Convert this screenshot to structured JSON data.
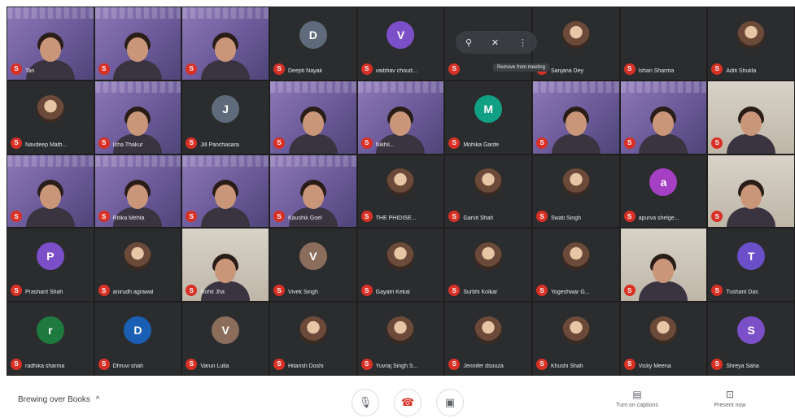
{
  "colors": {
    "grid_bg": "#1f1f20",
    "muted_badge": "#d93025",
    "accent": "#8e78b8"
  },
  "tiles": [
    {
      "row": 0,
      "col": 0,
      "type": "purple",
      "label": "Tan"
    },
    {
      "row": 0,
      "col": 1,
      "type": "purple",
      "label": ""
    },
    {
      "row": 0,
      "col": 2,
      "type": "purple",
      "label": ""
    },
    {
      "row": 0,
      "col": 3,
      "type": "avatar",
      "avatar": "D",
      "avatar_color": "#5f6b7a",
      "label": "Deepti Nayak"
    },
    {
      "row": 0,
      "col": 4,
      "type": "avatar",
      "avatar": "V",
      "avatar_color": "#7b4fc8",
      "label": "vaibhav choud..."
    },
    {
      "row": 0,
      "col": 5,
      "type": "dark",
      "label": ""
    },
    {
      "row": 0,
      "col": 6,
      "type": "photo",
      "label": "Sanjana Dey"
    },
    {
      "row": 0,
      "col": 7,
      "type": "dark",
      "label": "Ishan Sharma"
    },
    {
      "row": 0,
      "col": 8,
      "type": "photo",
      "label": "Aditi Shukla"
    },
    {
      "row": 1,
      "col": 0,
      "type": "photo",
      "label": "Navdeep Math..."
    },
    {
      "row": 1,
      "col": 1,
      "type": "purple",
      "label": "Isha Thakur"
    },
    {
      "row": 1,
      "col": 2,
      "type": "avatar",
      "avatar": "J",
      "avatar_color": "#5f6b7a",
      "label": "Jill Panchasara"
    },
    {
      "row": 1,
      "col": 3,
      "type": "purple",
      "label": ""
    },
    {
      "row": 1,
      "col": 4,
      "type": "purple",
      "label": "Nikhil..."
    },
    {
      "row": 1,
      "col": 5,
      "type": "avatar",
      "avatar": "M",
      "avatar_color": "#12a085",
      "label": "Mohika Garde"
    },
    {
      "row": 1,
      "col": 6,
      "type": "purple",
      "label": ""
    },
    {
      "row": 1,
      "col": 7,
      "type": "purple",
      "label": ""
    },
    {
      "row": 1,
      "col": 8,
      "type": "room",
      "label": ""
    },
    {
      "row": 2,
      "col": 0,
      "type": "purple",
      "label": ""
    },
    {
      "row": 2,
      "col": 1,
      "type": "purple",
      "label": "Ritika Mehta"
    },
    {
      "row": 2,
      "col": 2,
      "type": "purple",
      "label": ""
    },
    {
      "row": 2,
      "col": 3,
      "type": "purple",
      "label": "Kaushik Goel"
    },
    {
      "row": 2,
      "col": 4,
      "type": "photo",
      "label": "THE PHIDISE..."
    },
    {
      "row": 2,
      "col": 5,
      "type": "photo",
      "label": "Garvit Shah"
    },
    {
      "row": 2,
      "col": 6,
      "type": "photo",
      "label": "Swati Singh"
    },
    {
      "row": 2,
      "col": 7,
      "type": "avatar",
      "avatar": "a",
      "avatar_color": "#a53fc4",
      "label": "apurva shelge..."
    },
    {
      "row": 2,
      "col": 8,
      "type": "room",
      "label": ""
    },
    {
      "row": 3,
      "col": 0,
      "type": "avatar",
      "avatar": "P",
      "avatar_color": "#7b4fc8",
      "label": "Prashant Shah"
    },
    {
      "row": 3,
      "col": 1,
      "type": "photo",
      "label": "anirudh agrawal"
    },
    {
      "row": 3,
      "col": 2,
      "type": "room",
      "label": "Rohit Jha"
    },
    {
      "row": 3,
      "col": 3,
      "type": "avatar",
      "avatar": "V",
      "avatar_color": "#8a6d5b",
      "label": "Vivek Singh"
    },
    {
      "row": 3,
      "col": 4,
      "type": "photo",
      "label": "Gayatri Kekal"
    },
    {
      "row": 3,
      "col": 5,
      "type": "photo",
      "label": "Surbhi Kolkar"
    },
    {
      "row": 3,
      "col": 6,
      "type": "photo",
      "label": "Yogeshwar G..."
    },
    {
      "row": 3,
      "col": 7,
      "type": "room",
      "label": ""
    },
    {
      "row": 3,
      "col": 8,
      "type": "avatar",
      "avatar": "T",
      "avatar_color": "#6a4fc8",
      "label": "Tushant Das"
    },
    {
      "row": 4,
      "col": 0,
      "type": "avatar",
      "avatar": "r",
      "avatar_color": "#1e7a3e",
      "label": "radhika sharma"
    },
    {
      "row": 4,
      "col": 1,
      "type": "avatar",
      "avatar": "D",
      "avatar_color": "#1a5fb4",
      "label": "Dhruvi shah"
    },
    {
      "row": 4,
      "col": 2,
      "type": "avatar",
      "avatar": "V",
      "avatar_color": "#8a6d5b",
      "label": "Varun Lulla"
    },
    {
      "row": 4,
      "col": 3,
      "type": "photo",
      "label": "Hitansh Doshi"
    },
    {
      "row": 4,
      "col": 4,
      "type": "photo",
      "label": "Yuvraj Singh S..."
    },
    {
      "row": 4,
      "col": 5,
      "type": "photo",
      "label": "Jennifer dsouza"
    },
    {
      "row": 4,
      "col": 6,
      "type": "photo",
      "label": "Khushi Shah"
    },
    {
      "row": 4,
      "col": 7,
      "type": "photo",
      "label": "Vicky Meena"
    },
    {
      "row": 4,
      "col": 8,
      "type": "avatar",
      "avatar": "S",
      "avatar_color": "#7b4fc8",
      "label": "Shreya Saha"
    }
  ],
  "hover_controls": {
    "pin_icon": "pin-icon",
    "mute_icon": "mic-off-icon",
    "more_icon": "more-icon",
    "tooltip": "Remove from meeting"
  },
  "toolbar": {
    "meeting_title": "Brewing over Books",
    "chevron": "^",
    "mic_icon": "🎙",
    "hangup_icon": "☎",
    "camera_icon": "▣",
    "captions_label": "Turn on captions",
    "present_label": "Present now"
  }
}
